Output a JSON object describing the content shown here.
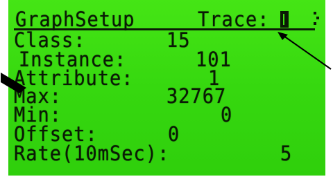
{
  "header": {
    "title": "GraphSetup",
    "trace_label": "Trace:",
    "trace_value": "1"
  },
  "fields": [
    {
      "label": "Class:",
      "value": "15"
    },
    {
      "label": "Instance:",
      "value": "101"
    },
    {
      "label": "Attribute:",
      "value": "1"
    },
    {
      "label": "Max:",
      "value": "32767"
    },
    {
      "label": "Min:",
      "value": "0"
    },
    {
      "label": "Offset:",
      "value": "0"
    },
    {
      "label": "Rate(10mSec):",
      "value": "5"
    }
  ],
  "colors": {
    "screen": "#3ee012",
    "text": "#0a1a05",
    "background": "#ffffff"
  }
}
